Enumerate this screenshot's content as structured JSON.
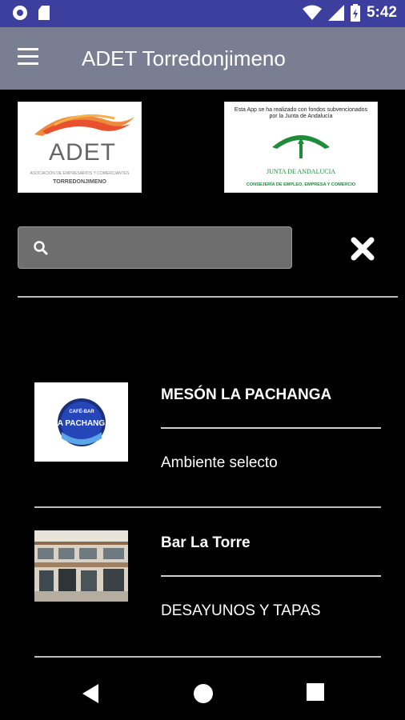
{
  "status_bar": {
    "time": "5:42",
    "icons": [
      "notification-circle-icon",
      "sd-card-icon",
      "wifi-icon",
      "cellular-signal-icon",
      "battery-icon"
    ],
    "color": "#3c3f9e"
  },
  "app_bar": {
    "title": "ADET Torredonjimeno",
    "menu_icon": "hamburger-menu-icon",
    "color": "#7a7e93"
  },
  "logos": {
    "adet": {
      "word": "ADET",
      "subtitle": "ASOCIACIÓN DE EMPRESARIOS Y COMERCIANTES",
      "city": "TORREDONJIMENO"
    },
    "junta": {
      "notice": "Esta App se ha realizado con fondos subvencionados por la Junta de Andalucía",
      "name": "JUNTA DE ANDALUCIA",
      "department": "CONSEJERÍA DE EMPLEO, EMPRESA Y COMERCIO"
    }
  },
  "search": {
    "value": "",
    "placeholder": "",
    "icon": "search-icon",
    "clear_icon": "close-icon"
  },
  "businesses": [
    {
      "name": "MESÓN LA PACHANGA",
      "description": "Ambiente selecto",
      "thumb_text_top": "CAFÉ-BAR",
      "thumb_text_main": "LA PACHANGA"
    },
    {
      "name": "Bar La Torre",
      "description": "DESAYUNOS Y TAPAS"
    }
  ],
  "nav_bar": {
    "buttons": [
      "back-icon",
      "home-icon",
      "recents-icon"
    ]
  }
}
